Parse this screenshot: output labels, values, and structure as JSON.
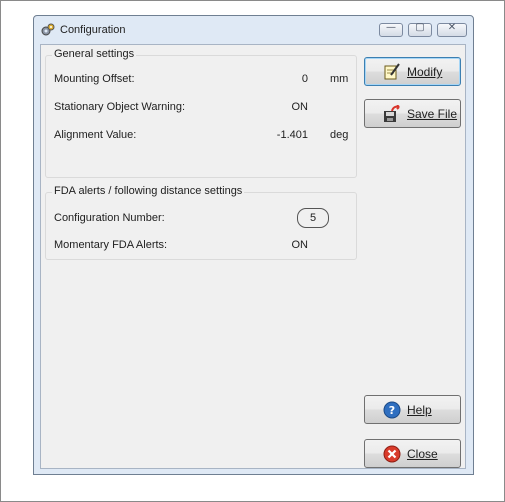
{
  "window": {
    "title": "Configuration",
    "controls": {
      "minimize": "—",
      "maximize": "▢",
      "close": "✕"
    }
  },
  "general": {
    "title": "General settings",
    "rows": [
      {
        "label": "Mounting Offset:",
        "value": "0",
        "unit": "mm"
      },
      {
        "label": "Stationary Object Warning:",
        "value": "ON",
        "unit": ""
      },
      {
        "label": "Alignment Value:",
        "value": "-1.401",
        "unit": "deg"
      }
    ]
  },
  "fda": {
    "title": "FDA alerts / following distance settings",
    "rows": [
      {
        "label": "Configuration Number:",
        "value": "5"
      },
      {
        "label": "Momentary FDA Alerts:",
        "value": "ON"
      }
    ]
  },
  "buttons": {
    "modify": "Modify",
    "save_file": "Save File",
    "help": "Help",
    "close": "Close"
  },
  "colors": {
    "title_bar": "#dfe9f5",
    "client_bg": "#f0f0f0",
    "default_button_border": "#3c7fb1",
    "close_icon": "#d93b2b",
    "help_icon": "#2f6fc0"
  }
}
